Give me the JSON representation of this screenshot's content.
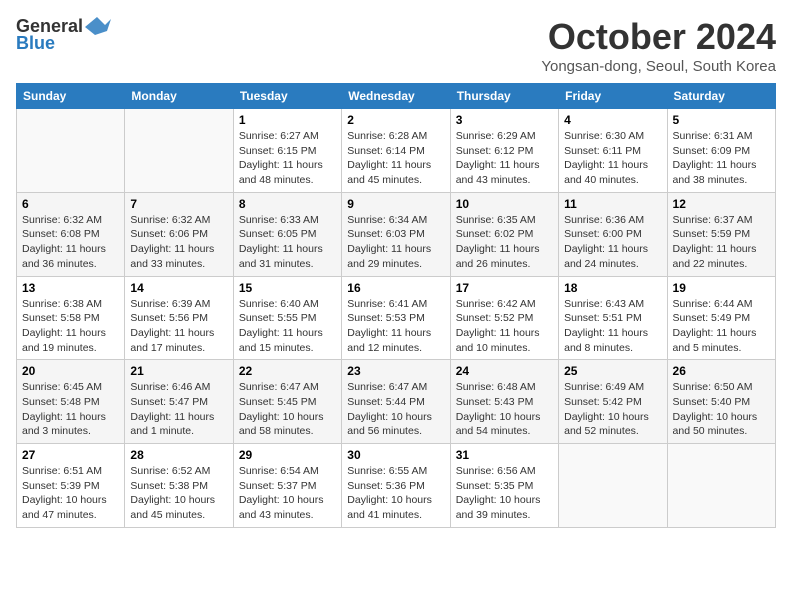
{
  "header": {
    "logo_general": "General",
    "logo_blue": "Blue",
    "month_title": "October 2024",
    "location": "Yongsan-dong, Seoul, South Korea"
  },
  "weekdays": [
    "Sunday",
    "Monday",
    "Tuesday",
    "Wednesday",
    "Thursday",
    "Friday",
    "Saturday"
  ],
  "weeks": [
    [
      {
        "day": "",
        "info": ""
      },
      {
        "day": "",
        "info": ""
      },
      {
        "day": "1",
        "info": "Sunrise: 6:27 AM\nSunset: 6:15 PM\nDaylight: 11 hours and 48 minutes."
      },
      {
        "day": "2",
        "info": "Sunrise: 6:28 AM\nSunset: 6:14 PM\nDaylight: 11 hours and 45 minutes."
      },
      {
        "day": "3",
        "info": "Sunrise: 6:29 AM\nSunset: 6:12 PM\nDaylight: 11 hours and 43 minutes."
      },
      {
        "day": "4",
        "info": "Sunrise: 6:30 AM\nSunset: 6:11 PM\nDaylight: 11 hours and 40 minutes."
      },
      {
        "day": "5",
        "info": "Sunrise: 6:31 AM\nSunset: 6:09 PM\nDaylight: 11 hours and 38 minutes."
      }
    ],
    [
      {
        "day": "6",
        "info": "Sunrise: 6:32 AM\nSunset: 6:08 PM\nDaylight: 11 hours and 36 minutes."
      },
      {
        "day": "7",
        "info": "Sunrise: 6:32 AM\nSunset: 6:06 PM\nDaylight: 11 hours and 33 minutes."
      },
      {
        "day": "8",
        "info": "Sunrise: 6:33 AM\nSunset: 6:05 PM\nDaylight: 11 hours and 31 minutes."
      },
      {
        "day": "9",
        "info": "Sunrise: 6:34 AM\nSunset: 6:03 PM\nDaylight: 11 hours and 29 minutes."
      },
      {
        "day": "10",
        "info": "Sunrise: 6:35 AM\nSunset: 6:02 PM\nDaylight: 11 hours and 26 minutes."
      },
      {
        "day": "11",
        "info": "Sunrise: 6:36 AM\nSunset: 6:00 PM\nDaylight: 11 hours and 24 minutes."
      },
      {
        "day": "12",
        "info": "Sunrise: 6:37 AM\nSunset: 5:59 PM\nDaylight: 11 hours and 22 minutes."
      }
    ],
    [
      {
        "day": "13",
        "info": "Sunrise: 6:38 AM\nSunset: 5:58 PM\nDaylight: 11 hours and 19 minutes."
      },
      {
        "day": "14",
        "info": "Sunrise: 6:39 AM\nSunset: 5:56 PM\nDaylight: 11 hours and 17 minutes."
      },
      {
        "day": "15",
        "info": "Sunrise: 6:40 AM\nSunset: 5:55 PM\nDaylight: 11 hours and 15 minutes."
      },
      {
        "day": "16",
        "info": "Sunrise: 6:41 AM\nSunset: 5:53 PM\nDaylight: 11 hours and 12 minutes."
      },
      {
        "day": "17",
        "info": "Sunrise: 6:42 AM\nSunset: 5:52 PM\nDaylight: 11 hours and 10 minutes."
      },
      {
        "day": "18",
        "info": "Sunrise: 6:43 AM\nSunset: 5:51 PM\nDaylight: 11 hours and 8 minutes."
      },
      {
        "day": "19",
        "info": "Sunrise: 6:44 AM\nSunset: 5:49 PM\nDaylight: 11 hours and 5 minutes."
      }
    ],
    [
      {
        "day": "20",
        "info": "Sunrise: 6:45 AM\nSunset: 5:48 PM\nDaylight: 11 hours and 3 minutes."
      },
      {
        "day": "21",
        "info": "Sunrise: 6:46 AM\nSunset: 5:47 PM\nDaylight: 11 hours and 1 minute."
      },
      {
        "day": "22",
        "info": "Sunrise: 6:47 AM\nSunset: 5:45 PM\nDaylight: 10 hours and 58 minutes."
      },
      {
        "day": "23",
        "info": "Sunrise: 6:47 AM\nSunset: 5:44 PM\nDaylight: 10 hours and 56 minutes."
      },
      {
        "day": "24",
        "info": "Sunrise: 6:48 AM\nSunset: 5:43 PM\nDaylight: 10 hours and 54 minutes."
      },
      {
        "day": "25",
        "info": "Sunrise: 6:49 AM\nSunset: 5:42 PM\nDaylight: 10 hours and 52 minutes."
      },
      {
        "day": "26",
        "info": "Sunrise: 6:50 AM\nSunset: 5:40 PM\nDaylight: 10 hours and 50 minutes."
      }
    ],
    [
      {
        "day": "27",
        "info": "Sunrise: 6:51 AM\nSunset: 5:39 PM\nDaylight: 10 hours and 47 minutes."
      },
      {
        "day": "28",
        "info": "Sunrise: 6:52 AM\nSunset: 5:38 PM\nDaylight: 10 hours and 45 minutes."
      },
      {
        "day": "29",
        "info": "Sunrise: 6:54 AM\nSunset: 5:37 PM\nDaylight: 10 hours and 43 minutes."
      },
      {
        "day": "30",
        "info": "Sunrise: 6:55 AM\nSunset: 5:36 PM\nDaylight: 10 hours and 41 minutes."
      },
      {
        "day": "31",
        "info": "Sunrise: 6:56 AM\nSunset: 5:35 PM\nDaylight: 10 hours and 39 minutes."
      },
      {
        "day": "",
        "info": ""
      },
      {
        "day": "",
        "info": ""
      }
    ]
  ]
}
